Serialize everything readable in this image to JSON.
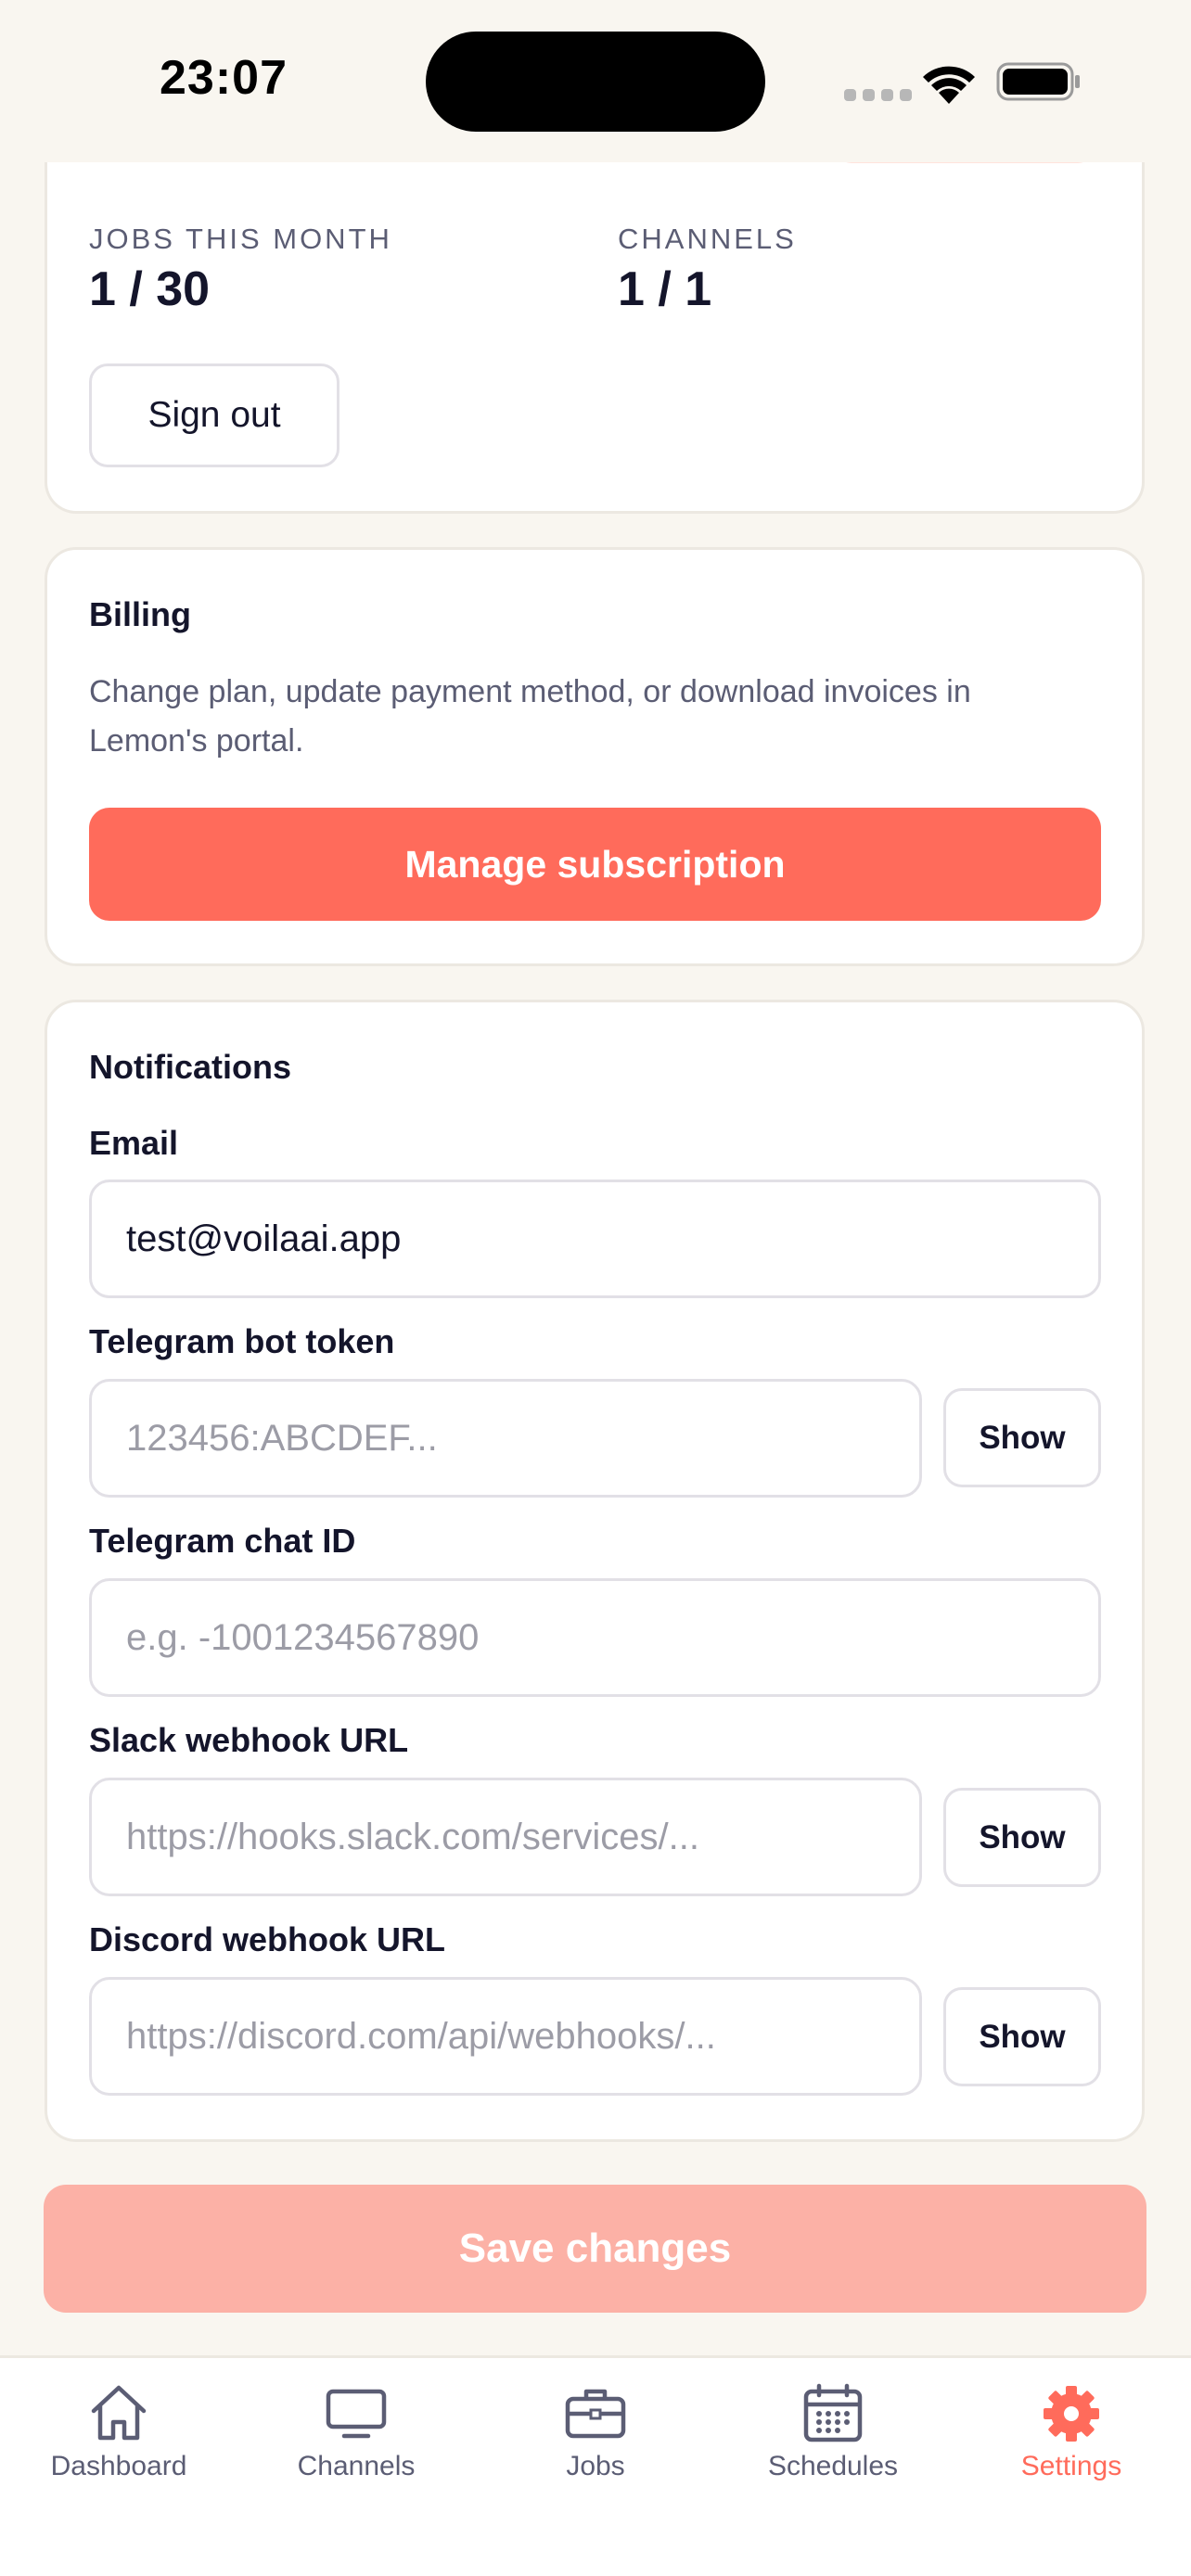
{
  "status_bar": {
    "time": "23:07"
  },
  "account": {
    "jobs_label": "JOBS THIS MONTH",
    "jobs_value": "1 / 30",
    "channels_label": "CHANNELS",
    "channels_value": "1 / 1",
    "sign_out_label": "Sign out"
  },
  "billing": {
    "title": "Billing",
    "description": "Change plan, update payment method, or download invoices in Lemon's portal.",
    "manage_label": "Manage subscription"
  },
  "notifications": {
    "title": "Notifications",
    "email_label": "Email",
    "email_value": "test@voilaai.app",
    "telegram_token_label": "Telegram bot token",
    "telegram_token_placeholder": "123456:ABCDEF...",
    "telegram_chat_label": "Telegram chat ID",
    "telegram_chat_placeholder": "e.g. -1001234567890",
    "slack_label": "Slack webhook URL",
    "slack_placeholder": "https://hooks.slack.com/services/...",
    "discord_label": "Discord webhook URL",
    "discord_placeholder": "https://discord.com/api/webhooks/...",
    "show_label": "Show"
  },
  "save_label": "Save changes",
  "tabs": [
    {
      "label": "Dashboard",
      "icon": "house-icon",
      "active": false
    },
    {
      "label": "Channels",
      "icon": "monitor-icon",
      "active": false
    },
    {
      "label": "Jobs",
      "icon": "briefcase-icon",
      "active": false
    },
    {
      "label": "Schedules",
      "icon": "calendar-icon",
      "active": false
    },
    {
      "label": "Settings",
      "icon": "gear-icon",
      "active": true
    }
  ],
  "colors": {
    "accent": "#ff6b5b",
    "accent_disabled": "#fcb1a6",
    "background": "#f9f6f0",
    "text": "#14152b",
    "muted_text": "#5b5d74"
  }
}
